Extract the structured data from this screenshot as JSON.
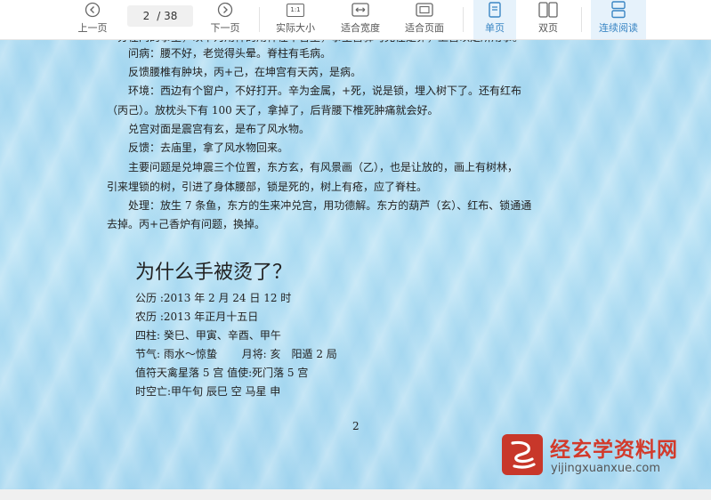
{
  "toolbar": {
    "prev_page": "上一页",
    "page_current": "2",
    "page_total": "/ 38",
    "next_page": "下一页",
    "actual_size": "实际大小",
    "actual_size_glyph": "1:1",
    "fit_width": "适合宽度",
    "fit_page": "适合页面",
    "single_page": "单页",
    "double_page": "双页",
    "continuous": "连续阅读",
    "accent_color": "#3a86c4"
  },
  "document": {
    "cut_line": "一分在问的事主，以下为用神的用神在午官里，事主宫驿马克在是卯，上宫以定所用事。",
    "paragraphs": [
      "　　问病：腰不好，老觉得头晕。脊柱有毛病。",
      "　　反馈腰椎有肿块，丙+己，在坤宫有天芮，是病。",
      "　　环境：西边有个窗户，不好打开。辛为金属，+死，说是锁，埋入树下了。还有红布",
      "（丙己）。放枕头下有 100 天了，拿掉了，后背腰下椎死肿痛就会好。",
      "　　兑宫对面是震宫有玄，是布了风水物。",
      "　　反馈：去庙里，拿了风水物回来。",
      "　　主要问题是兑坤震三个位置，东方玄，有风景画（乙），也是让放的，画上有树林，",
      "引来埋锁的树，引进了身体腰部，锁是死的，树上有疮，应了脊柱。",
      "　　处理：放生 7 条鱼，东方的生来冲兑宫，用功德解。东方的葫芦（玄）、红布、锁通通",
      "去掉。丙+己香炉有问题，换掉。"
    ],
    "heading": "为什么手被烫了？",
    "info_lines": [
      "公历 :2013 年 2 月 24 日 12 时",
      "农历 :2013 年正月十五日",
      "四柱: 癸巳、甲寅、辛酉、甲午",
      "节气: 雨水～惊蛰　　 月将: 亥　阳遁 2 局",
      "值符天禽星落 5 宫 值使:死门落 5 宫",
      "时空亡:甲午旬 辰巳 空 马星 申"
    ],
    "page_number": "2"
  },
  "watermark": {
    "title": "经玄学资料网",
    "url": "yijingxuanxue.com",
    "logo_color": "#c8372a"
  }
}
